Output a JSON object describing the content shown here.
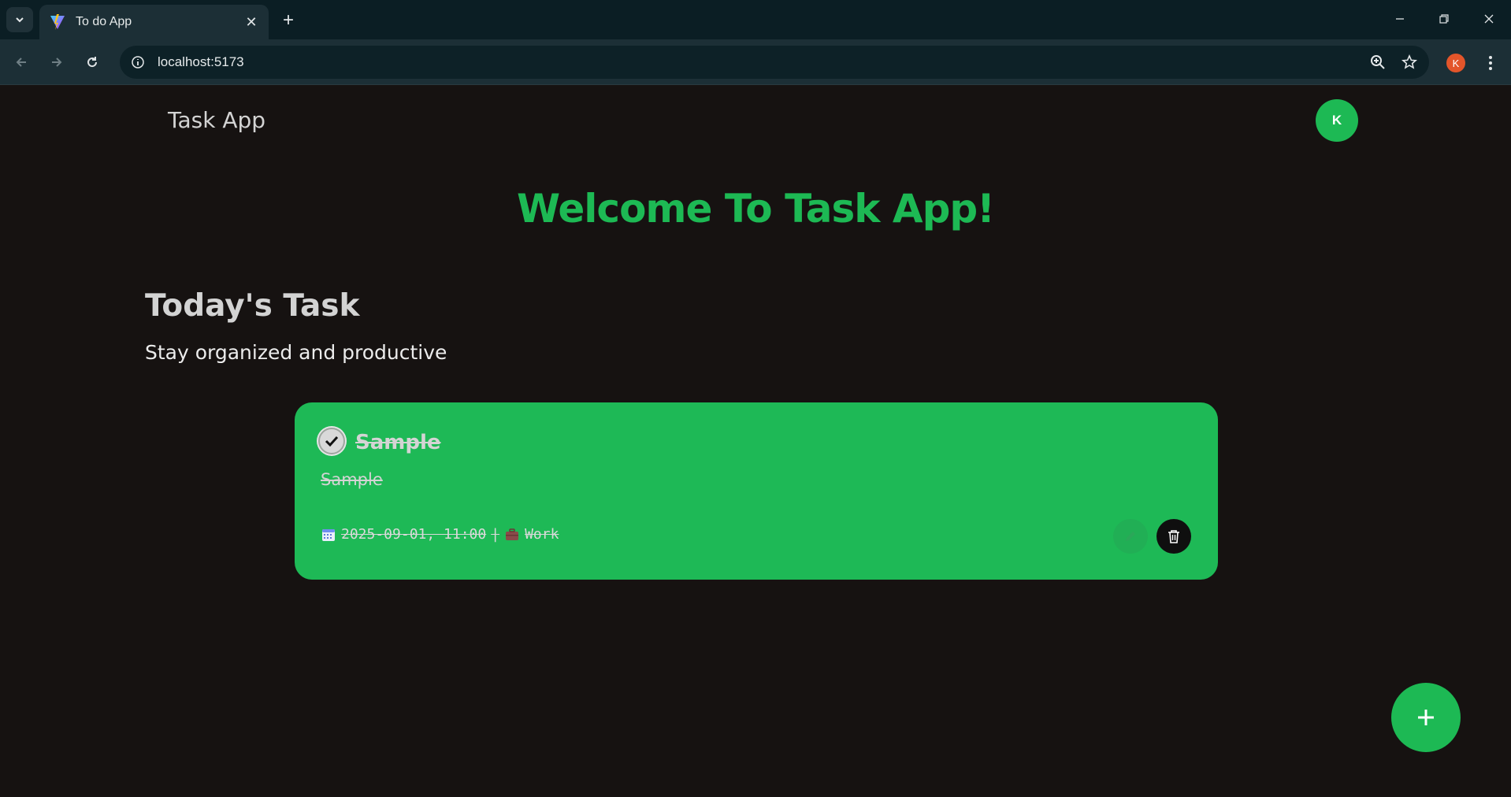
{
  "browser": {
    "tab_title": "To do App",
    "url": "localhost:5173",
    "profile_initial": "K"
  },
  "header": {
    "brand": "Task App",
    "avatar_initial": "K"
  },
  "welcome": "Welcome To Task App!",
  "section": {
    "title": "Today's Task",
    "subtitle": "Stay organized and productive"
  },
  "tasks": [
    {
      "title": "Sample",
      "description": "Sample",
      "datetime": "2025-09-01, 11:00",
      "separator": "|",
      "category": "Work",
      "completed": true
    }
  ],
  "colors": {
    "accent": "#1db954",
    "background": "#161211",
    "card": "#1eb956"
  },
  "icons": {
    "fab": "plus-icon",
    "edit": "pencil-icon",
    "delete": "trash-icon",
    "date": "calendar-icon",
    "category": "briefcase-icon"
  }
}
